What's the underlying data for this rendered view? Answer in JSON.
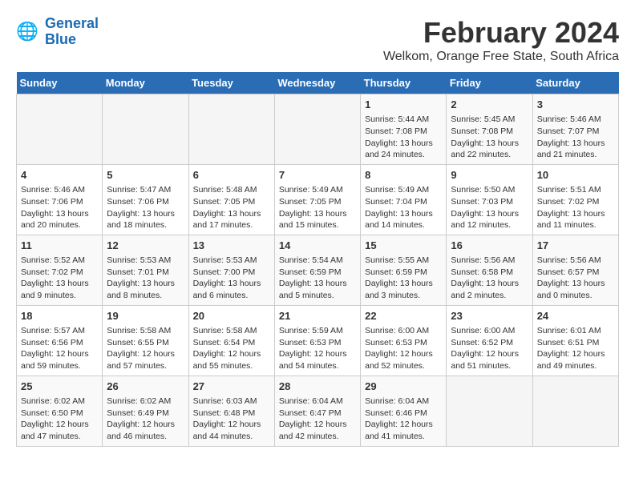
{
  "header": {
    "logo_line1": "General",
    "logo_line2": "Blue",
    "title": "February 2024",
    "subtitle": "Welkom, Orange Free State, South Africa"
  },
  "days_of_week": [
    "Sunday",
    "Monday",
    "Tuesday",
    "Wednesday",
    "Thursday",
    "Friday",
    "Saturday"
  ],
  "weeks": [
    [
      {
        "day": "",
        "info": ""
      },
      {
        "day": "",
        "info": ""
      },
      {
        "day": "",
        "info": ""
      },
      {
        "day": "",
        "info": ""
      },
      {
        "day": "1",
        "info": "Sunrise: 5:44 AM\nSunset: 7:08 PM\nDaylight: 13 hours and 24 minutes."
      },
      {
        "day": "2",
        "info": "Sunrise: 5:45 AM\nSunset: 7:08 PM\nDaylight: 13 hours and 22 minutes."
      },
      {
        "day": "3",
        "info": "Sunrise: 5:46 AM\nSunset: 7:07 PM\nDaylight: 13 hours and 21 minutes."
      }
    ],
    [
      {
        "day": "4",
        "info": "Sunrise: 5:46 AM\nSunset: 7:06 PM\nDaylight: 13 hours and 20 minutes."
      },
      {
        "day": "5",
        "info": "Sunrise: 5:47 AM\nSunset: 7:06 PM\nDaylight: 13 hours and 18 minutes."
      },
      {
        "day": "6",
        "info": "Sunrise: 5:48 AM\nSunset: 7:05 PM\nDaylight: 13 hours and 17 minutes."
      },
      {
        "day": "7",
        "info": "Sunrise: 5:49 AM\nSunset: 7:05 PM\nDaylight: 13 hours and 15 minutes."
      },
      {
        "day": "8",
        "info": "Sunrise: 5:49 AM\nSunset: 7:04 PM\nDaylight: 13 hours and 14 minutes."
      },
      {
        "day": "9",
        "info": "Sunrise: 5:50 AM\nSunset: 7:03 PM\nDaylight: 13 hours and 12 minutes."
      },
      {
        "day": "10",
        "info": "Sunrise: 5:51 AM\nSunset: 7:02 PM\nDaylight: 13 hours and 11 minutes."
      }
    ],
    [
      {
        "day": "11",
        "info": "Sunrise: 5:52 AM\nSunset: 7:02 PM\nDaylight: 13 hours and 9 minutes."
      },
      {
        "day": "12",
        "info": "Sunrise: 5:53 AM\nSunset: 7:01 PM\nDaylight: 13 hours and 8 minutes."
      },
      {
        "day": "13",
        "info": "Sunrise: 5:53 AM\nSunset: 7:00 PM\nDaylight: 13 hours and 6 minutes."
      },
      {
        "day": "14",
        "info": "Sunrise: 5:54 AM\nSunset: 6:59 PM\nDaylight: 13 hours and 5 minutes."
      },
      {
        "day": "15",
        "info": "Sunrise: 5:55 AM\nSunset: 6:59 PM\nDaylight: 13 hours and 3 minutes."
      },
      {
        "day": "16",
        "info": "Sunrise: 5:56 AM\nSunset: 6:58 PM\nDaylight: 13 hours and 2 minutes."
      },
      {
        "day": "17",
        "info": "Sunrise: 5:56 AM\nSunset: 6:57 PM\nDaylight: 13 hours and 0 minutes."
      }
    ],
    [
      {
        "day": "18",
        "info": "Sunrise: 5:57 AM\nSunset: 6:56 PM\nDaylight: 12 hours and 59 minutes."
      },
      {
        "day": "19",
        "info": "Sunrise: 5:58 AM\nSunset: 6:55 PM\nDaylight: 12 hours and 57 minutes."
      },
      {
        "day": "20",
        "info": "Sunrise: 5:58 AM\nSunset: 6:54 PM\nDaylight: 12 hours and 55 minutes."
      },
      {
        "day": "21",
        "info": "Sunrise: 5:59 AM\nSunset: 6:53 PM\nDaylight: 12 hours and 54 minutes."
      },
      {
        "day": "22",
        "info": "Sunrise: 6:00 AM\nSunset: 6:53 PM\nDaylight: 12 hours and 52 minutes."
      },
      {
        "day": "23",
        "info": "Sunrise: 6:00 AM\nSunset: 6:52 PM\nDaylight: 12 hours and 51 minutes."
      },
      {
        "day": "24",
        "info": "Sunrise: 6:01 AM\nSunset: 6:51 PM\nDaylight: 12 hours and 49 minutes."
      }
    ],
    [
      {
        "day": "25",
        "info": "Sunrise: 6:02 AM\nSunset: 6:50 PM\nDaylight: 12 hours and 47 minutes."
      },
      {
        "day": "26",
        "info": "Sunrise: 6:02 AM\nSunset: 6:49 PM\nDaylight: 12 hours and 46 minutes."
      },
      {
        "day": "27",
        "info": "Sunrise: 6:03 AM\nSunset: 6:48 PM\nDaylight: 12 hours and 44 minutes."
      },
      {
        "day": "28",
        "info": "Sunrise: 6:04 AM\nSunset: 6:47 PM\nDaylight: 12 hours and 42 minutes."
      },
      {
        "day": "29",
        "info": "Sunrise: 6:04 AM\nSunset: 6:46 PM\nDaylight: 12 hours and 41 minutes."
      },
      {
        "day": "",
        "info": ""
      },
      {
        "day": "",
        "info": ""
      }
    ]
  ]
}
